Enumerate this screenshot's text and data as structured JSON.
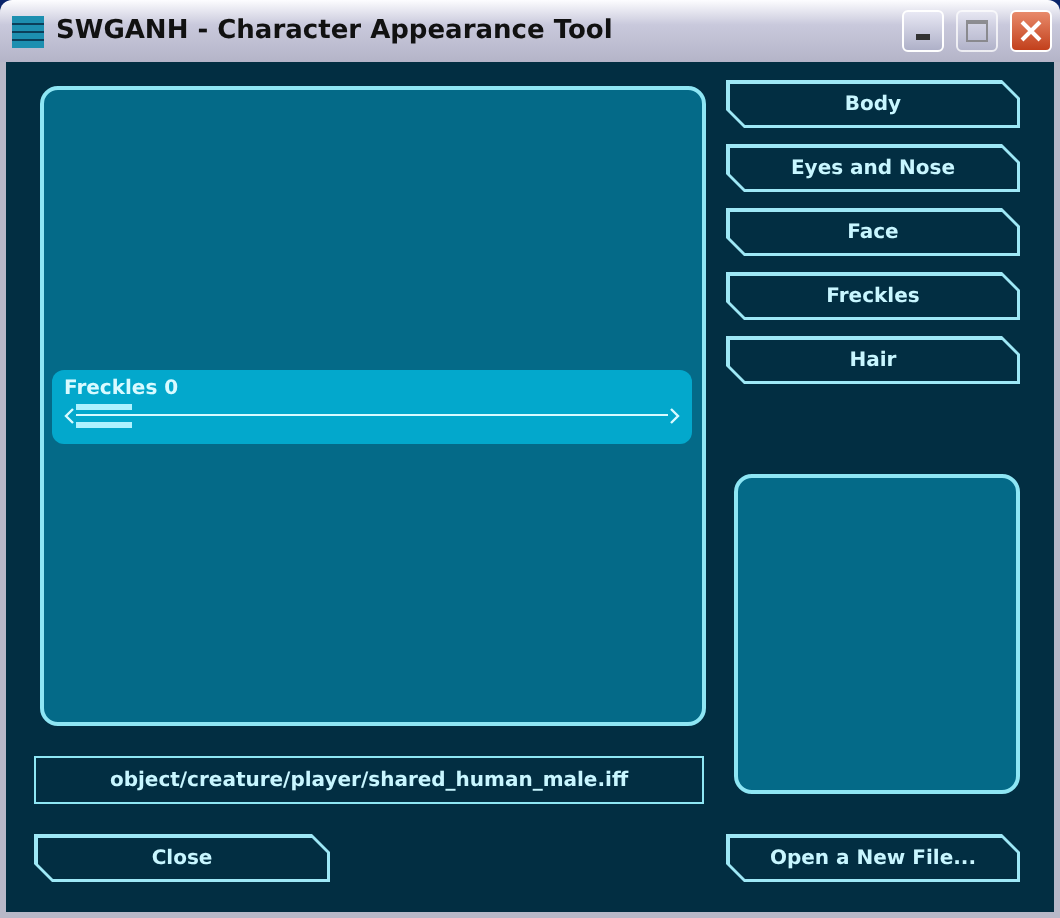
{
  "window": {
    "title": "SWGANH - Character Appearance Tool"
  },
  "slider": {
    "label": "Freckles 0",
    "level": 0
  },
  "categories": [
    {
      "label": "Body"
    },
    {
      "label": "Eyes and Nose"
    },
    {
      "label": "Face"
    },
    {
      "label": "Freckles"
    },
    {
      "label": "Hair"
    }
  ],
  "file_path": "object/creature/player/shared_human_male.iff",
  "buttons": [
    {
      "label": "Close"
    },
    {
      "label": "Open a New File..."
    }
  ]
}
